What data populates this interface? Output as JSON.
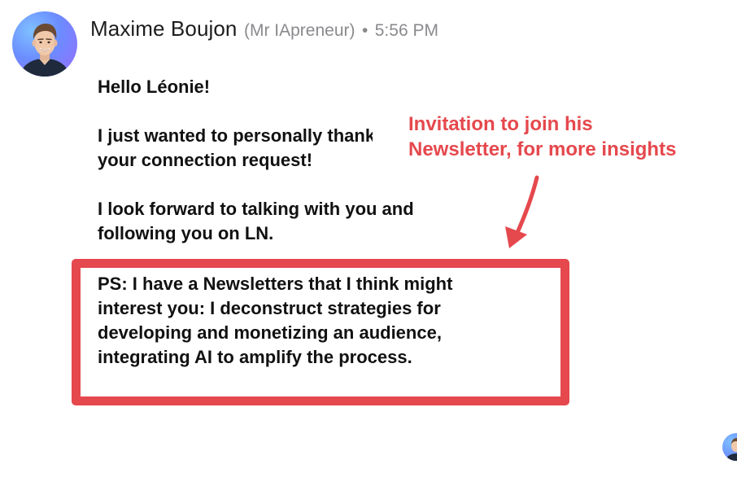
{
  "sender": {
    "name": "Maxime Boujon",
    "alias": "(Mr IApreneur)",
    "separator": "•",
    "time": "5:56 PM"
  },
  "message": {
    "greeting": "Hello Léonie!",
    "thanks_line1": "I just wanted to personally thank you for accepting",
    "thanks_line2": "your connection request!",
    "forward_line1": "I look forward to talking with you and",
    "forward_line2": "following you on LN.",
    "ps_lines": [
      "PS: I have a Newsletters that I think might",
      "interest you: I deconstruct strategies for",
      "developing and monetizing an audience,",
      "integrating AI to amplify the process."
    ]
  },
  "annotation": {
    "line1": "Invitation to join his",
    "line2": "Newsletter, for more insights",
    "color": "#e5484d"
  },
  "icons": {
    "avatar": "profile-photo",
    "small_avatar": "profile-photo",
    "arrow": "arrow-down-icon"
  }
}
